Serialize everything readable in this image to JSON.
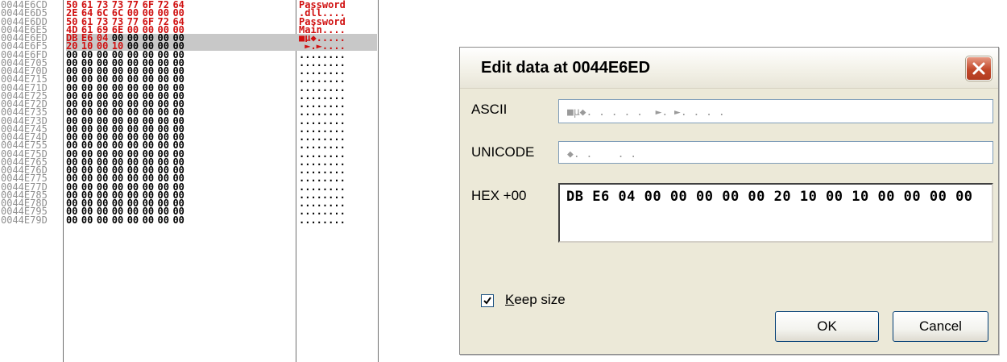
{
  "hexdump": {
    "rows": [
      {
        "addr": "0044E6CD",
        "hex": [
          "50",
          "61",
          "73",
          "73",
          "77",
          "6F",
          "72",
          "64"
        ],
        "ascii": "Password",
        "color": "red"
      },
      {
        "addr": "0044E6D5",
        "hex": [
          "2E",
          "64",
          "6C",
          "6C",
          "00",
          "00",
          "00",
          "00"
        ],
        "ascii": ".dll....",
        "color": "red"
      },
      {
        "addr": "0044E6DD",
        "hex": [
          "50",
          "61",
          "73",
          "73",
          "77",
          "6F",
          "72",
          "64"
        ],
        "ascii": "Password",
        "color": "red"
      },
      {
        "addr": "0044E6E5",
        "hex": [
          "4D",
          "61",
          "69",
          "6E",
          "00",
          "00",
          "00",
          "00"
        ],
        "ascii": "Main....",
        "color": "red"
      },
      {
        "addr": "0044E6ED",
        "hex": [
          "DB",
          "E6",
          "04",
          "00",
          "00",
          "00",
          "00",
          "00"
        ],
        "ascii": "■µ◆.....",
        "color": "red-partial",
        "selected": true
      },
      {
        "addr": "0044E6F5",
        "hex": [
          "20",
          "10",
          "00",
          "10",
          "00",
          "00",
          "00",
          "00"
        ],
        "ascii": " ►.►....",
        "color": "red-partial",
        "selected": true
      },
      {
        "addr": "0044E6FD",
        "hex": [
          "00",
          "00",
          "00",
          "00",
          "00",
          "00",
          "00",
          "00"
        ],
        "ascii": "........"
      },
      {
        "addr": "0044E705",
        "hex": [
          "00",
          "00",
          "00",
          "00",
          "00",
          "00",
          "00",
          "00"
        ],
        "ascii": "........"
      },
      {
        "addr": "0044E70D",
        "hex": [
          "00",
          "00",
          "00",
          "00",
          "00",
          "00",
          "00",
          "00"
        ],
        "ascii": "........"
      },
      {
        "addr": "0044E715",
        "hex": [
          "00",
          "00",
          "00",
          "00",
          "00",
          "00",
          "00",
          "00"
        ],
        "ascii": "........"
      },
      {
        "addr": "0044E71D",
        "hex": [
          "00",
          "00",
          "00",
          "00",
          "00",
          "00",
          "00",
          "00"
        ],
        "ascii": "........"
      },
      {
        "addr": "0044E725",
        "hex": [
          "00",
          "00",
          "00",
          "00",
          "00",
          "00",
          "00",
          "00"
        ],
        "ascii": "........"
      },
      {
        "addr": "0044E72D",
        "hex": [
          "00",
          "00",
          "00",
          "00",
          "00",
          "00",
          "00",
          "00"
        ],
        "ascii": "........"
      },
      {
        "addr": "0044E735",
        "hex": [
          "00",
          "00",
          "00",
          "00",
          "00",
          "00",
          "00",
          "00"
        ],
        "ascii": "........"
      },
      {
        "addr": "0044E73D",
        "hex": [
          "00",
          "00",
          "00",
          "00",
          "00",
          "00",
          "00",
          "00"
        ],
        "ascii": "........"
      },
      {
        "addr": "0044E745",
        "hex": [
          "00",
          "00",
          "00",
          "00",
          "00",
          "00",
          "00",
          "00"
        ],
        "ascii": "........"
      },
      {
        "addr": "0044E74D",
        "hex": [
          "00",
          "00",
          "00",
          "00",
          "00",
          "00",
          "00",
          "00"
        ],
        "ascii": "........"
      },
      {
        "addr": "0044E755",
        "hex": [
          "00",
          "00",
          "00",
          "00",
          "00",
          "00",
          "00",
          "00"
        ],
        "ascii": "........"
      },
      {
        "addr": "0044E75D",
        "hex": [
          "00",
          "00",
          "00",
          "00",
          "00",
          "00",
          "00",
          "00"
        ],
        "ascii": "........"
      },
      {
        "addr": "0044E765",
        "hex": [
          "00",
          "00",
          "00",
          "00",
          "00",
          "00",
          "00",
          "00"
        ],
        "ascii": "........"
      },
      {
        "addr": "0044E76D",
        "hex": [
          "00",
          "00",
          "00",
          "00",
          "00",
          "00",
          "00",
          "00"
        ],
        "ascii": "........"
      },
      {
        "addr": "0044E775",
        "hex": [
          "00",
          "00",
          "00",
          "00",
          "00",
          "00",
          "00",
          "00"
        ],
        "ascii": "........"
      },
      {
        "addr": "0044E77D",
        "hex": [
          "00",
          "00",
          "00",
          "00",
          "00",
          "00",
          "00",
          "00"
        ],
        "ascii": "........"
      },
      {
        "addr": "0044E785",
        "hex": [
          "00",
          "00",
          "00",
          "00",
          "00",
          "00",
          "00",
          "00"
        ],
        "ascii": "........"
      },
      {
        "addr": "0044E78D",
        "hex": [
          "00",
          "00",
          "00",
          "00",
          "00",
          "00",
          "00",
          "00"
        ],
        "ascii": "........"
      },
      {
        "addr": "0044E795",
        "hex": [
          "00",
          "00",
          "00",
          "00",
          "00",
          "00",
          "00",
          "00"
        ],
        "ascii": "........"
      },
      {
        "addr": "0044E79D",
        "hex": [
          "00",
          "00",
          "00",
          "00",
          "00",
          "00",
          "00",
          "00"
        ],
        "ascii": "........"
      }
    ],
    "colors": {
      "modified": "#d01010",
      "normal": "#000000",
      "address": "#909090",
      "selection": "#c8c8c8"
    }
  },
  "dialog": {
    "title": "Edit data at 0044E6ED",
    "close_icon": "close-icon",
    "ascii_label": "ASCII",
    "ascii_value": "■µ◆. . . . .  ►. ►. . . .",
    "unicode_label": "UNICODE",
    "unicode_value": "◆. .    . .",
    "hex_label": "HEX +00",
    "hex_value": "DB E6 04 00 00 00 00 00 20 10 00 10 00 00 00 00",
    "keep_size_label_pre": "",
    "keep_size_label_u": "K",
    "keep_size_label_post": "eep size",
    "keep_size_checked": true,
    "ok_label": "OK",
    "cancel_label": "Cancel",
    "colors": {
      "face": "#ece9d8",
      "close_red": "#c2482a",
      "field_border": "#7f9db9"
    }
  }
}
